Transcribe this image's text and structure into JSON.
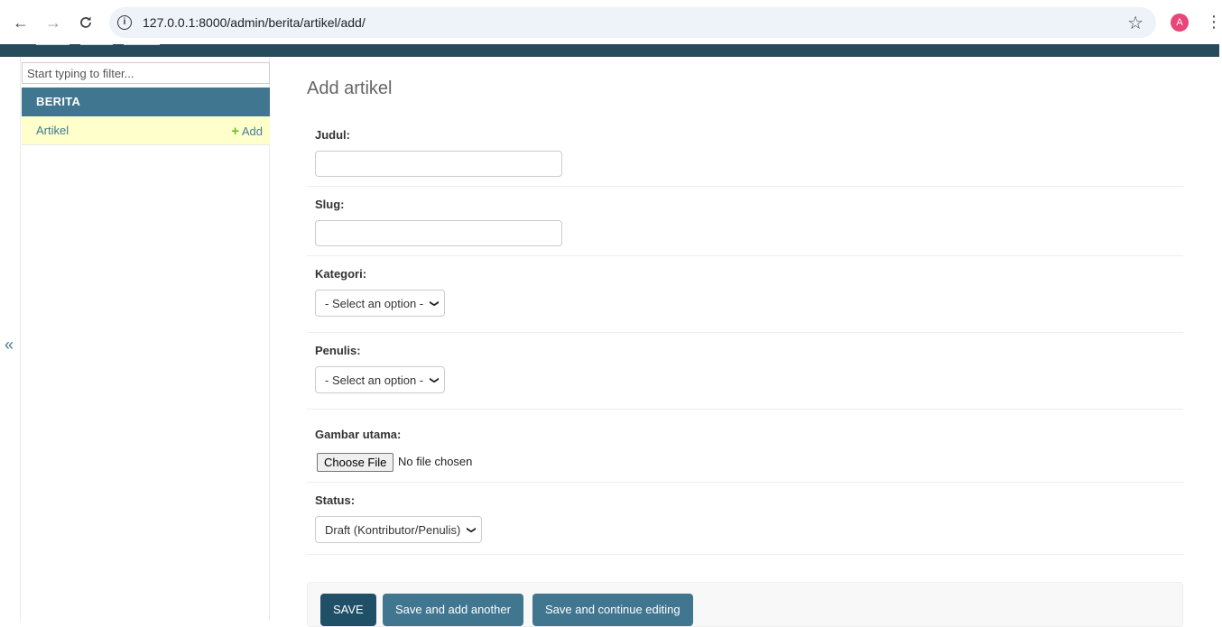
{
  "browser": {
    "url": "127.0.0.1:8000/admin/berita/artikel/add/",
    "avatar_letter": "A"
  },
  "sidebar": {
    "filter_placeholder": "Start typing to filter...",
    "app_name": "BERITA",
    "models": [
      {
        "label": "Artikel",
        "add_label": "Add"
      }
    ],
    "collapse_label": "«"
  },
  "main": {
    "title": "Add artikel",
    "fields": {
      "judul": {
        "label": "Judul:",
        "value": ""
      },
      "slug": {
        "label": "Slug:",
        "value": ""
      },
      "kategori": {
        "label": "Kategori:",
        "selected": "- Select an option -"
      },
      "penulis": {
        "label": "Penulis:",
        "selected": "- Select an option -"
      },
      "gambar": {
        "label": "Gambar utama:",
        "button": "Choose File",
        "status": "No file chosen"
      },
      "status": {
        "label": "Status:",
        "selected": "Draft (Kontributor/Penulis)"
      }
    },
    "buttons": {
      "save": "SAVE",
      "save_add_another": "Save and add another",
      "save_continue": "Save and continue editing"
    }
  },
  "colors": {
    "header": "#264b5d",
    "primary": "#417690",
    "save_button": "#205067",
    "selected_row": "#ffffcc",
    "add_plus": "#70bf2b"
  }
}
